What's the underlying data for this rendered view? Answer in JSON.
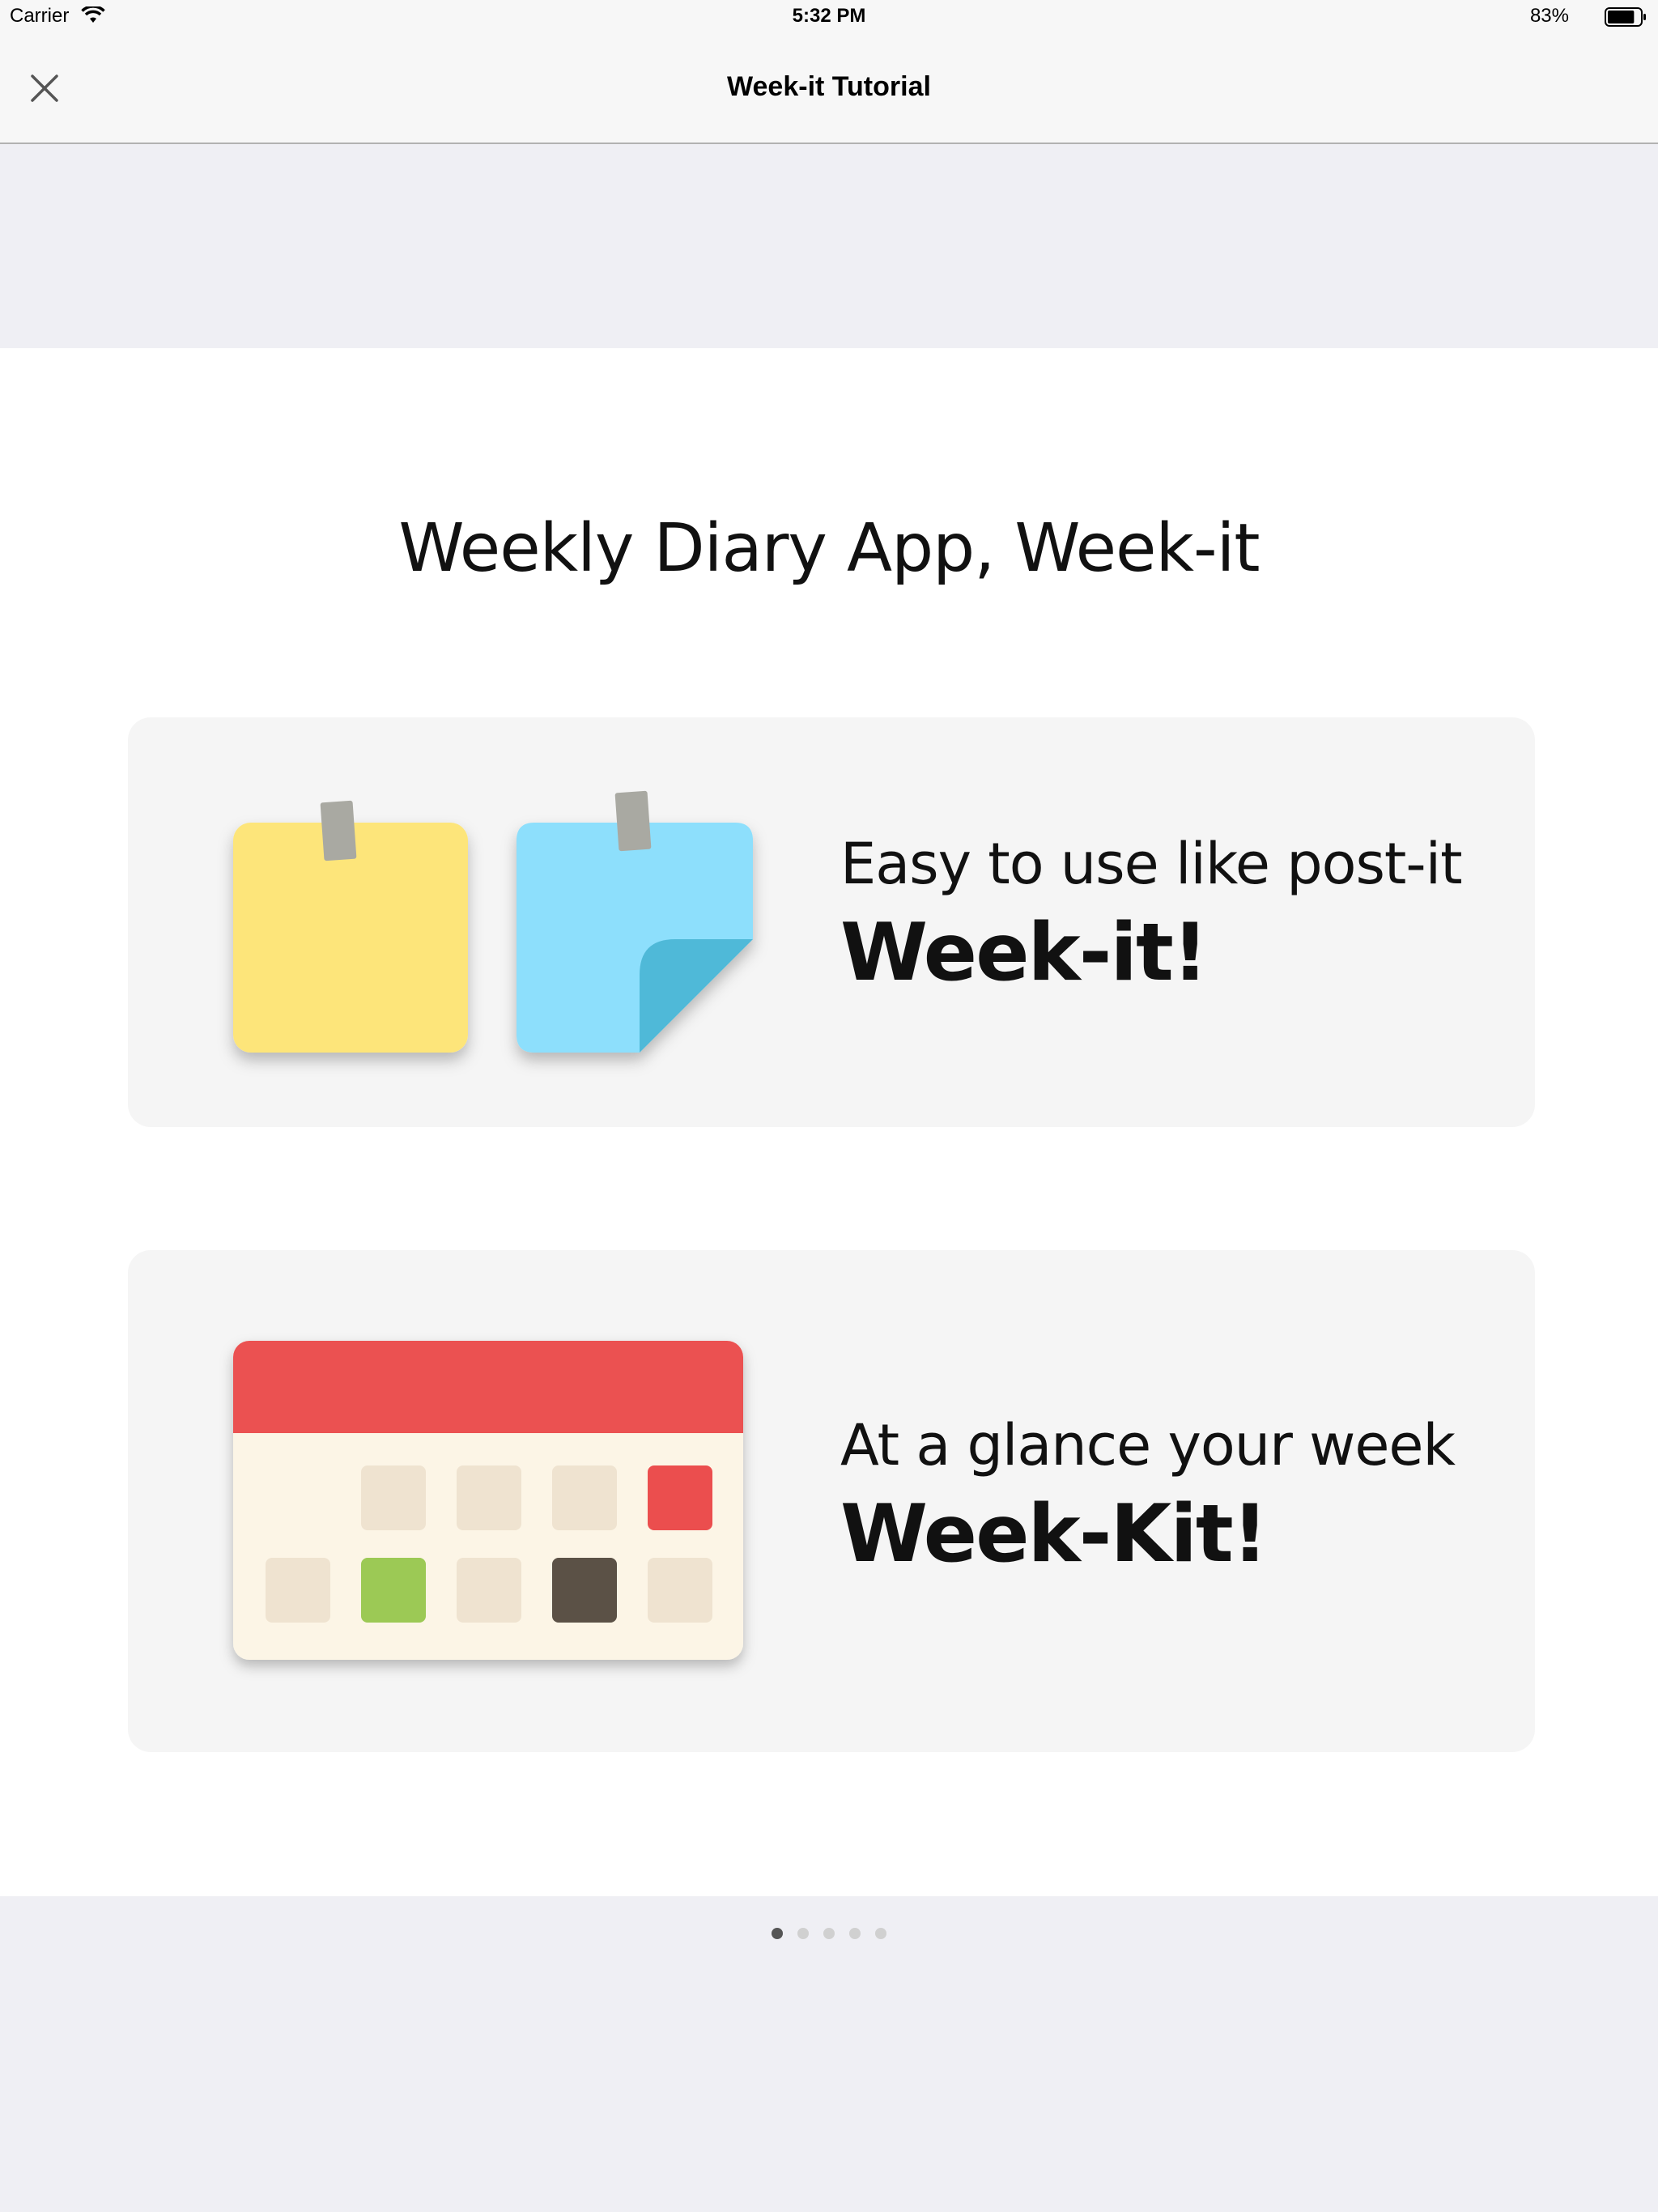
{
  "status_bar": {
    "carrier": "Carrier",
    "time": "5:32 PM",
    "battery_percent": "83%",
    "battery_level": 0.83
  },
  "nav": {
    "title": "Week-it Tutorial",
    "close_icon": "close-icon"
  },
  "tutorial": {
    "headline": "Weekly Diary App, Week-it",
    "cards": [
      {
        "line1": "Easy to use like post-it",
        "line2": "Week-it!",
        "icon": "sticky-notes-icon"
      },
      {
        "line1": "At a glance your week",
        "line2": "Week-Kit!",
        "icon": "calendar-icon"
      }
    ]
  },
  "pagination": {
    "total": 5,
    "current": 1
  },
  "colors": {
    "yellow_note": "#fde57a",
    "blue_note": "#8ddffc",
    "blue_fold": "#4fb9d8",
    "calendar_header": "#eb5151",
    "calendar_body": "#fcf5e6",
    "calendar_cell": "#efe3d0",
    "calendar_red": "#eb4e4e",
    "calendar_green": "#9cc955",
    "calendar_dark": "#5b5146"
  }
}
